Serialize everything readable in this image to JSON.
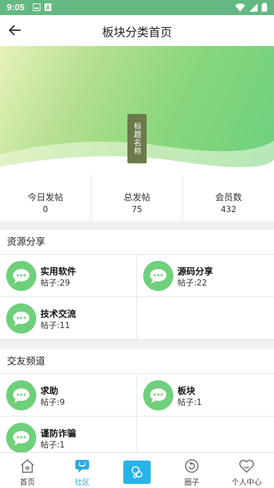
{
  "status": {
    "time": "9:05"
  },
  "header": {
    "title": "板块分类首页"
  },
  "banner": {
    "tag": "标题名称"
  },
  "stats": [
    {
      "label": "今日发帖",
      "value": "0"
    },
    {
      "label": "总发帖",
      "value": "75"
    },
    {
      "label": "会员数",
      "value": "432"
    }
  ],
  "sections": [
    {
      "title": "资源分享",
      "boards": [
        {
          "name": "实用软件",
          "count": "帖子:29"
        },
        {
          "name": "源码分享",
          "count": "帖子:22"
        },
        {
          "name": "技术交流",
          "count": "帖子:11"
        }
      ]
    },
    {
      "title": "交友频道",
      "boards": [
        {
          "name": "求助",
          "count": "帖子:9"
        },
        {
          "name": "板块",
          "count": "帖子:1"
        },
        {
          "name": "谨防诈骗",
          "count": "帖子:1"
        }
      ]
    }
  ],
  "tabs": [
    {
      "label": "首页",
      "icon": "home-icon"
    },
    {
      "label": "社区",
      "icon": "chat-icon"
    },
    {
      "label": "",
      "icon": "center-publish-icon"
    },
    {
      "label": "圈子",
      "icon": "refresh-circle-icon"
    },
    {
      "label": "个人中心",
      "icon": "heart-face-icon"
    }
  ],
  "colors": {
    "accent": "#2fa8e0",
    "board_icon": "#6fd07b",
    "statusbar": "#64b881"
  }
}
